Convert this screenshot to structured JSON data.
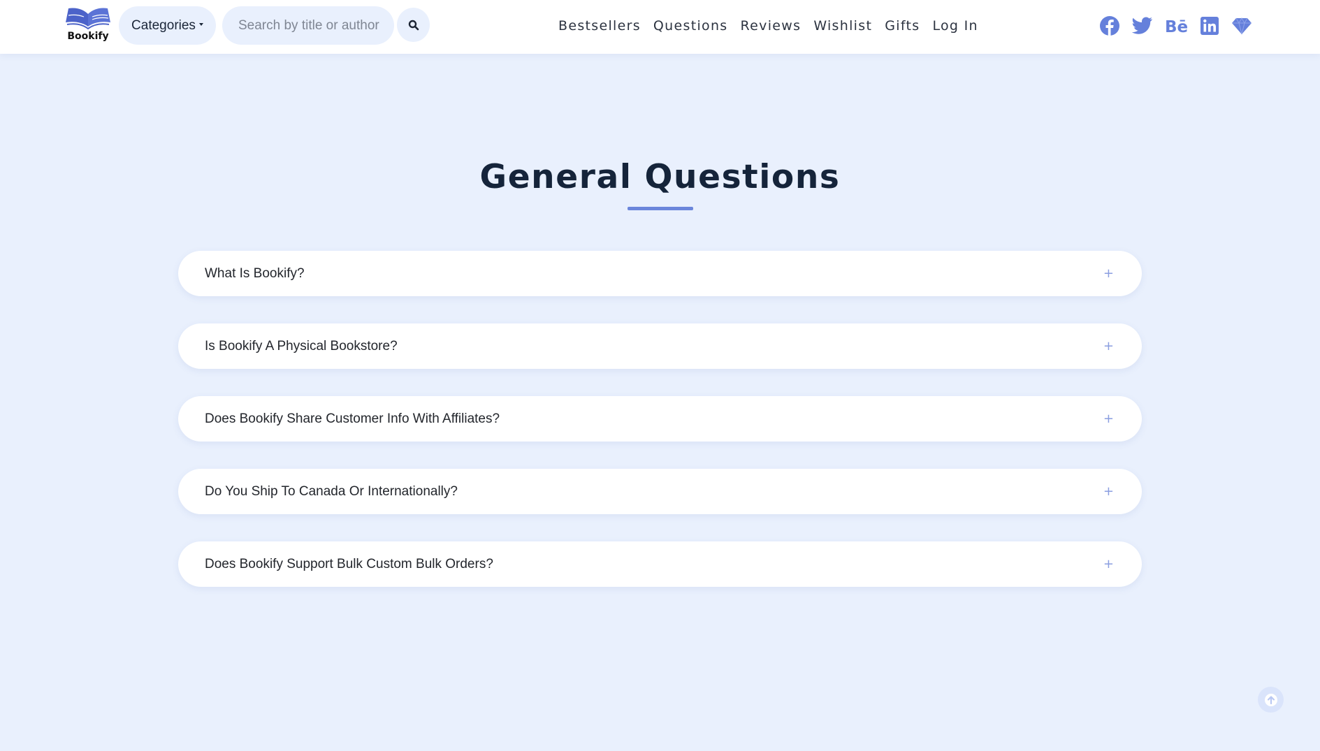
{
  "brand": {
    "name": "Bookify",
    "logo_icon": "open-book-icon"
  },
  "header": {
    "categories_label": "Categories",
    "search_placeholder": "Search by title or author",
    "search_icon": "magnifier-icon",
    "nav": [
      "Bestsellers",
      "Questions",
      "Reviews",
      "Wishlist",
      "Gifts",
      "Log In"
    ],
    "social": [
      "facebook-icon",
      "twitter-icon",
      "behance-icon",
      "linkedin-icon",
      "diamond-icon"
    ]
  },
  "main": {
    "title": "General Questions",
    "faqs": [
      {
        "question": "What Is Bookify?",
        "toggle": "+"
      },
      {
        "question": "Is Bookify A Physical Bookstore?",
        "toggle": "+"
      },
      {
        "question": "Does Bookify Share Customer Info With Affiliates?",
        "toggle": "+"
      },
      {
        "question": "Do You Ship To Canada Or Internationally?",
        "toggle": "+"
      },
      {
        "question": "Does Bookify Support Bulk Custom Bulk Orders?",
        "toggle": "+"
      }
    ]
  },
  "scroll_top_icon": "arrow-up-icon",
  "colors": {
    "accent": "#6b86db",
    "background": "#e9f0fd",
    "social_icon": "#6580db",
    "title": "#15243a"
  }
}
